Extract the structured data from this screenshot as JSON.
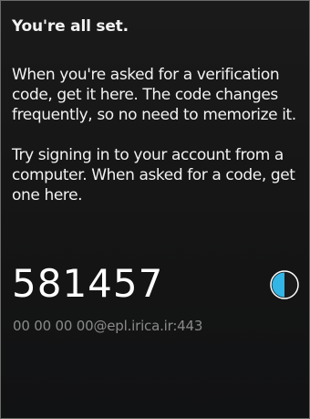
{
  "header": {
    "title": "You're all set."
  },
  "body": {
    "paragraph1": "When you're asked for a verification code, get it here. The code changes frequently, so no need to memorize it.",
    "paragraph2": "Try signing in to your account from a computer. When asked for a code, get one here."
  },
  "account": {
    "code": "581457",
    "name": "00 00 00 00@epl.irica.ir:443",
    "timer_icon": "countdown-pie-icon",
    "timer_remaining_fraction": 0.5
  },
  "colors": {
    "background": "#151515",
    "text": "#f2f2f2",
    "muted": "#8a8a8a",
    "accent": "#33b5e5"
  }
}
